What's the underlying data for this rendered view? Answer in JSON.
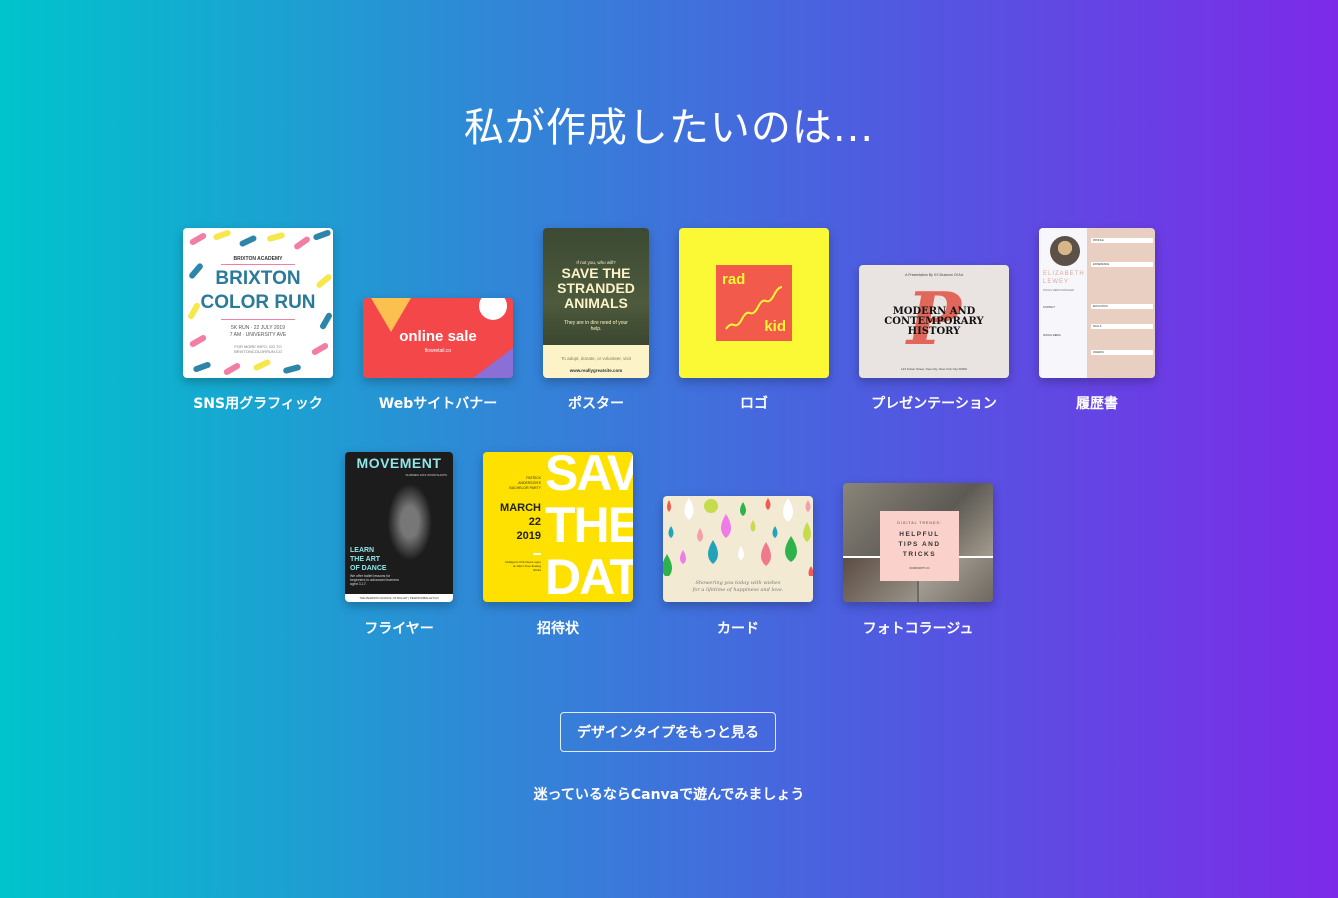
{
  "page": {
    "title": "私が作成したいのは...",
    "colors": {
      "gradient_start": "#00c4cc",
      "gradient_end": "#7d2ae8"
    }
  },
  "design_types": [
    {
      "label": "SNS用グラフィック",
      "thumb": {
        "top": "BRIXTON ACADEMY",
        "headline_1": "BRIXTON",
        "headline_2": "COLOR RUN",
        "line_1": "5K RUN  ·  22 JULY 2019",
        "line_2": "7 AM  ·  UNIVERSITY AVE",
        "line_3": "FOR MORE INFO, GO TO",
        "line_4": "BRIXTONCOLORRUN.CO"
      }
    },
    {
      "label": "Webサイトバナー",
      "thumb": {
        "headline": "online sale",
        "sub": "flowretail.co"
      }
    },
    {
      "label": "ポスター",
      "thumb": {
        "top": "If not you, who will?",
        "headline": "SAVE THE STRANDED ANIMALS",
        "sub": "They are in dire need of your help.",
        "footer_1": "To adopt, donate, or volunteer, visit",
        "footer_2": "www.reallygreatsite.com"
      }
    },
    {
      "label": "ロゴ",
      "thumb": {
        "word_1": "rad",
        "word_2": "kid"
      }
    },
    {
      "label": "プレゼンテーション",
      "thumb": {
        "top": "A Presentation By XX Museum Of Art",
        "big_letter": "P",
        "headline": "MODERN AND CONTEMPORARY HISTORY",
        "footer": "123 Fulton Street, New City, New York City 00000"
      }
    },
    {
      "label": "履歴書",
      "thumb": {
        "name_1": "ELIZABETH",
        "name_2": "LEWEY",
        "role": "SOCIAL MEDIA MANAGER",
        "sections": [
          "PROFILE",
          "EXPERIENCE",
          "EDUCATION",
          "SKILLS",
          "AWARDS"
        ],
        "left_sections": [
          "CONTACT",
          "SOCIAL MEDIA"
        ]
      }
    },
    {
      "label": "フライヤー",
      "thumb": {
        "headline": "MOVEMENT",
        "sub": "SUMMER 2019 WORKSHOPS",
        "tag": "LEARN THE ART OF DANCE",
        "body": "We offer ballet lessons for beginners to advanced learners aged 3-17.",
        "footer": "THE PEARSON SCHOOL OF BALLET  |  PEARSONBALLET.CO"
      }
    },
    {
      "label": "招待状",
      "thumb": {
        "big": [
          "SAVE",
          "THE",
          "DATE"
        ],
        "host": "PATRICK ANDERSON'S BACHELOR PARTY",
        "date_1": "MARCH",
        "date_2": "22",
        "date_3": "2019",
        "details": "Mulligan's Pub Doors open at 10pm Free flowing drinks"
      }
    },
    {
      "label": "カード",
      "thumb": {
        "line_1": "Showering you today with wishes",
        "line_2": "for a lifetime of happiness and love."
      }
    },
    {
      "label": "フォトコラージュ",
      "thumb": {
        "top": "DIGITAL TRENDS:",
        "headline": "HELPFUL TIPS AND TRICKS",
        "footer": "WORDSMITH.CO"
      }
    }
  ],
  "actions": {
    "more_button": "デザインタイプをもっと見る",
    "play_link": "迷っているならCanvaで遊んでみましょう"
  }
}
